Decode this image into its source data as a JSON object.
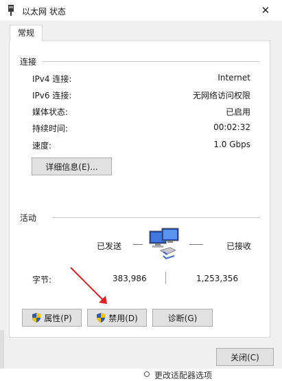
{
  "window": {
    "title": "以太网 状态",
    "close_glyph": "✕"
  },
  "tabs": [
    {
      "label": "常规"
    }
  ],
  "connection": {
    "heading": "连接",
    "rows": [
      {
        "label": "IPv4 连接:",
        "value": "Internet"
      },
      {
        "label": "IPv6 连接:",
        "value": "无网络访问权限"
      },
      {
        "label": "媒体状态:",
        "value": "已启用"
      },
      {
        "label": "持续时间:",
        "value": "00:02:32"
      },
      {
        "label": "速度:",
        "value": "1.0 Gbps"
      }
    ],
    "details_button": "详细信息(E)..."
  },
  "activity": {
    "heading": "活动",
    "sent_label": "已发送",
    "received_label": "已接收",
    "bytes_label": "字节:",
    "bytes_sent": "383,986",
    "bytes_received": "1,253,356"
  },
  "buttons": {
    "properties": "属性(P)",
    "disable": "禁用(D)",
    "diagnose": "诊断(G)",
    "close": "关闭(C)"
  },
  "background": {
    "partial_text": "更改适配器选项"
  },
  "colors": {
    "annotation_arrow": "#e02020",
    "shield_blue": "#2a5caa",
    "shield_yellow": "#f2c200"
  }
}
